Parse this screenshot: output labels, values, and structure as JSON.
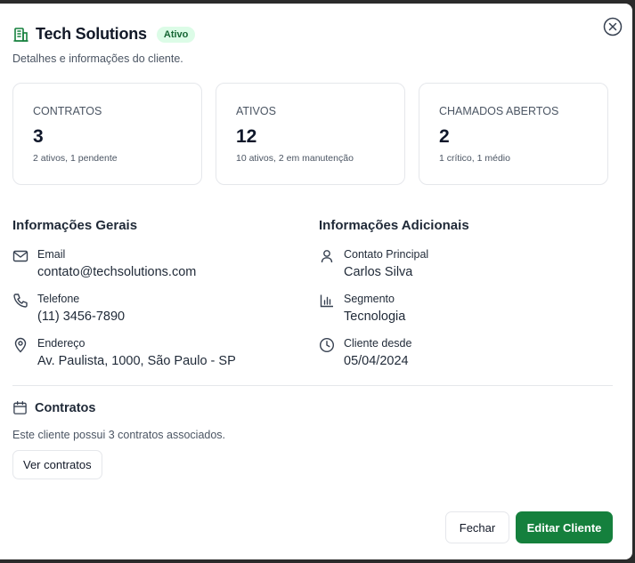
{
  "dialog": {
    "title": "Tech Solutions",
    "status_badge": "Ativo",
    "subtitle": "Detalhes e informações do cliente."
  },
  "stats": [
    {
      "label": "CONTRATOS",
      "value": "3",
      "detail": "2 ativos, 1 pendente"
    },
    {
      "label": "ATIVOS",
      "value": "12",
      "detail": "10 ativos, 2 em manutenção"
    },
    {
      "label": "CHAMADOS ABERTOS",
      "value": "2",
      "detail": "1 crítico, 1 médio"
    }
  ],
  "general_info": {
    "heading": "Informações Gerais",
    "items": [
      {
        "label": "Email",
        "value": "contato@techsolutions.com",
        "icon": "mail-icon"
      },
      {
        "label": "Telefone",
        "value": "(11) 3456-7890",
        "icon": "phone-icon"
      },
      {
        "label": "Endereço",
        "value": "Av. Paulista, 1000, São Paulo - SP",
        "icon": "map-pin-icon"
      }
    ]
  },
  "additional_info": {
    "heading": "Informações Adicionais",
    "items": [
      {
        "label": "Contato Principal",
        "value": "Carlos Silva",
        "icon": "user-icon"
      },
      {
        "label": "Segmento",
        "value": "Tecnologia",
        "icon": "bar-chart-icon"
      },
      {
        "label": "Cliente desde",
        "value": "05/04/2024",
        "icon": "clock-icon"
      }
    ]
  },
  "contracts": {
    "heading": "Contratos",
    "text": "Este cliente possui 3 contratos associados.",
    "button": "Ver contratos"
  },
  "footer": {
    "close": "Fechar",
    "edit": "Editar Cliente"
  },
  "colors": {
    "accent": "#15803d",
    "badge_bg": "#dcfce7",
    "badge_text": "#166534"
  }
}
